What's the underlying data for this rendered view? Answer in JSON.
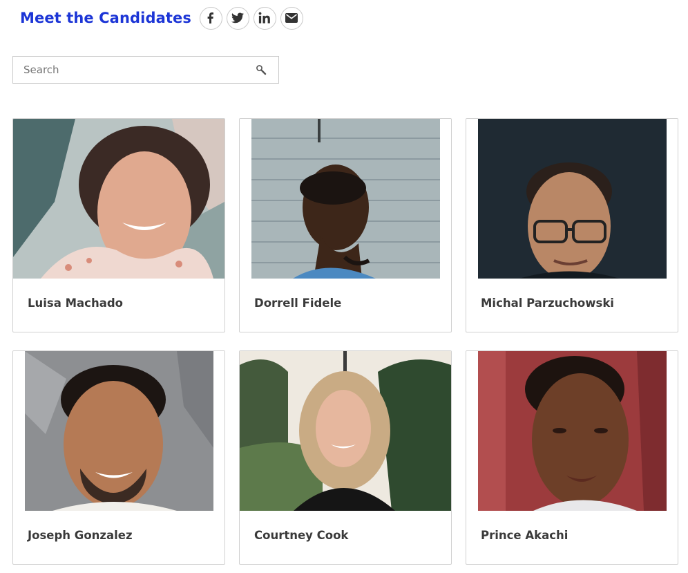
{
  "header": {
    "title": "Meet the Candidates",
    "share": [
      {
        "icon": "facebook-icon",
        "label": "Facebook"
      },
      {
        "icon": "twitter-icon",
        "label": "Twitter"
      },
      {
        "icon": "linkedin-icon",
        "label": "LinkedIn"
      },
      {
        "icon": "email-icon",
        "label": "Email"
      }
    ]
  },
  "search": {
    "placeholder": "Search",
    "value": "",
    "icon": "search-icon"
  },
  "candidates": [
    {
      "name": "Luisa Machado"
    },
    {
      "name": "Dorrell Fidele"
    },
    {
      "name": "Michal Parzuchowski"
    },
    {
      "name": "Joseph Gonzalez"
    },
    {
      "name": "Courtney Cook"
    },
    {
      "name": "Prince Akachi"
    }
  ],
  "colors": {
    "title": "#1c35d6",
    "name_text": "#3a3a3a",
    "border": "#d0d0d0"
  }
}
